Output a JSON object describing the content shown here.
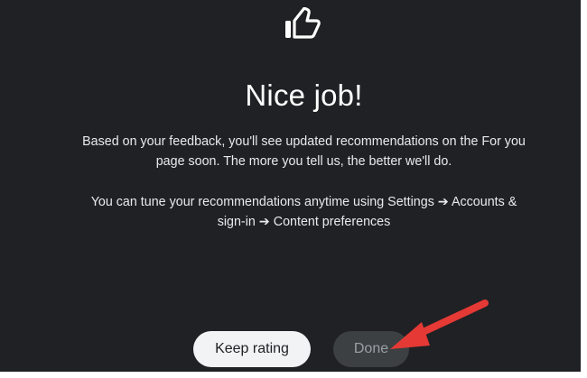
{
  "dialog": {
    "icon": "thumbs-up-icon",
    "title": "Nice job!",
    "paragraph1": {
      "line1": "Based on your feedback, you'll see updated recommendations on the For you",
      "line2": "page soon. The more you tell us, the better we'll do."
    },
    "paragraph2": {
      "line1": "You can tune your recommendations anytime using Settings ➔ Accounts &",
      "line2": "sign-in ➔ Content preferences"
    },
    "buttons": {
      "keep_rating": "Keep rating",
      "done": "Done"
    }
  },
  "annotation": {
    "icon": "red-arrow-icon",
    "color": "#e53935"
  },
  "colors": {
    "background": "#202124",
    "primary_button": "#f1f3f4",
    "secondary_button": "#3c4043"
  }
}
